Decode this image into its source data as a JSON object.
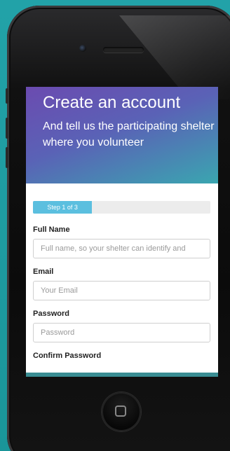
{
  "header": {
    "title": "Create an account",
    "subtitle": "And tell us the participating shelter where you volunteer"
  },
  "progress": {
    "label": "Step 1 of 3",
    "fraction": 0.333
  },
  "form": {
    "full_name": {
      "label": "Full Name",
      "placeholder": "Full name, so your shelter can identify and"
    },
    "email": {
      "label": "Email",
      "placeholder": "Your Email"
    },
    "password": {
      "label": "Password",
      "placeholder": "Password"
    },
    "confirm_password": {
      "label": "Confirm Password"
    }
  },
  "colors": {
    "background": "#1e9aa0",
    "header_start": "#6b4bb0",
    "header_end": "#3aa6b0",
    "progress_fill": "#5bbfdf"
  },
  "icons": {
    "home": "home-button-square-icon",
    "camera": "front-camera-icon",
    "speaker": "earpiece-speaker-icon"
  }
}
